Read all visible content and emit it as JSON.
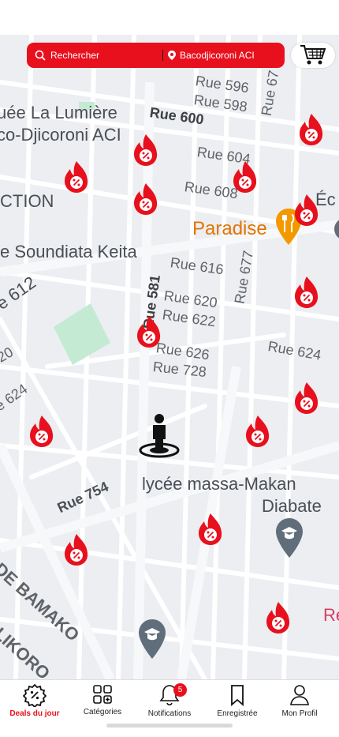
{
  "search": {
    "placeholder": "Rechercher",
    "location": "Bacodjicoroni ACI"
  },
  "map": {
    "labels": [
      {
        "text": "Rue 596"
      },
      {
        "text": "Rue 598"
      },
      {
        "text": "Rue 600"
      },
      {
        "text": "Rue 67"
      },
      {
        "text": "uée La Lumière"
      },
      {
        "text": "co-Djicoroni ACI"
      },
      {
        "text": "Rue 604"
      },
      {
        "text": "Rue 608"
      },
      {
        "text": "CTION"
      },
      {
        "text": "Éc"
      },
      {
        "text": "Paradise"
      },
      {
        "text": "e Soundiata Keita"
      },
      {
        "text": "Rue 616"
      },
      {
        "text": "Rue 677"
      },
      {
        "text": "Rue 581"
      },
      {
        "text": "e 612"
      },
      {
        "text": "Rue 620"
      },
      {
        "text": "Rue 622"
      },
      {
        "text": "Rue 626"
      },
      {
        "text": "Rue 624"
      },
      {
        "text": "Rue 728"
      },
      {
        "text": "20"
      },
      {
        "text": "e 624"
      },
      {
        "text": "lycée massa-Makan"
      },
      {
        "text": "Diabate"
      },
      {
        "text": "Rue 754"
      },
      {
        "text": "DE BAMAKO"
      },
      {
        "text": "LIKORO"
      },
      {
        "text": "Re"
      }
    ],
    "deal_icon": "fire-discount-icon",
    "user_icon": "person-location-icon",
    "poi_icons": [
      "restaurant-pin-icon",
      "school-pin-icon"
    ],
    "accent": "#e8101d"
  },
  "nav": {
    "items": [
      {
        "label": "Deals du jour",
        "icon": "discount-badge-icon",
        "active": true
      },
      {
        "label": "Catégories",
        "icon": "categories-grid-icon"
      },
      {
        "label": "Notifications",
        "icon": "bell-icon",
        "badge": "5"
      },
      {
        "label": "Enregistrée",
        "icon": "bookmark-icon"
      },
      {
        "label": "Mon Profil",
        "icon": "user-icon"
      }
    ]
  }
}
